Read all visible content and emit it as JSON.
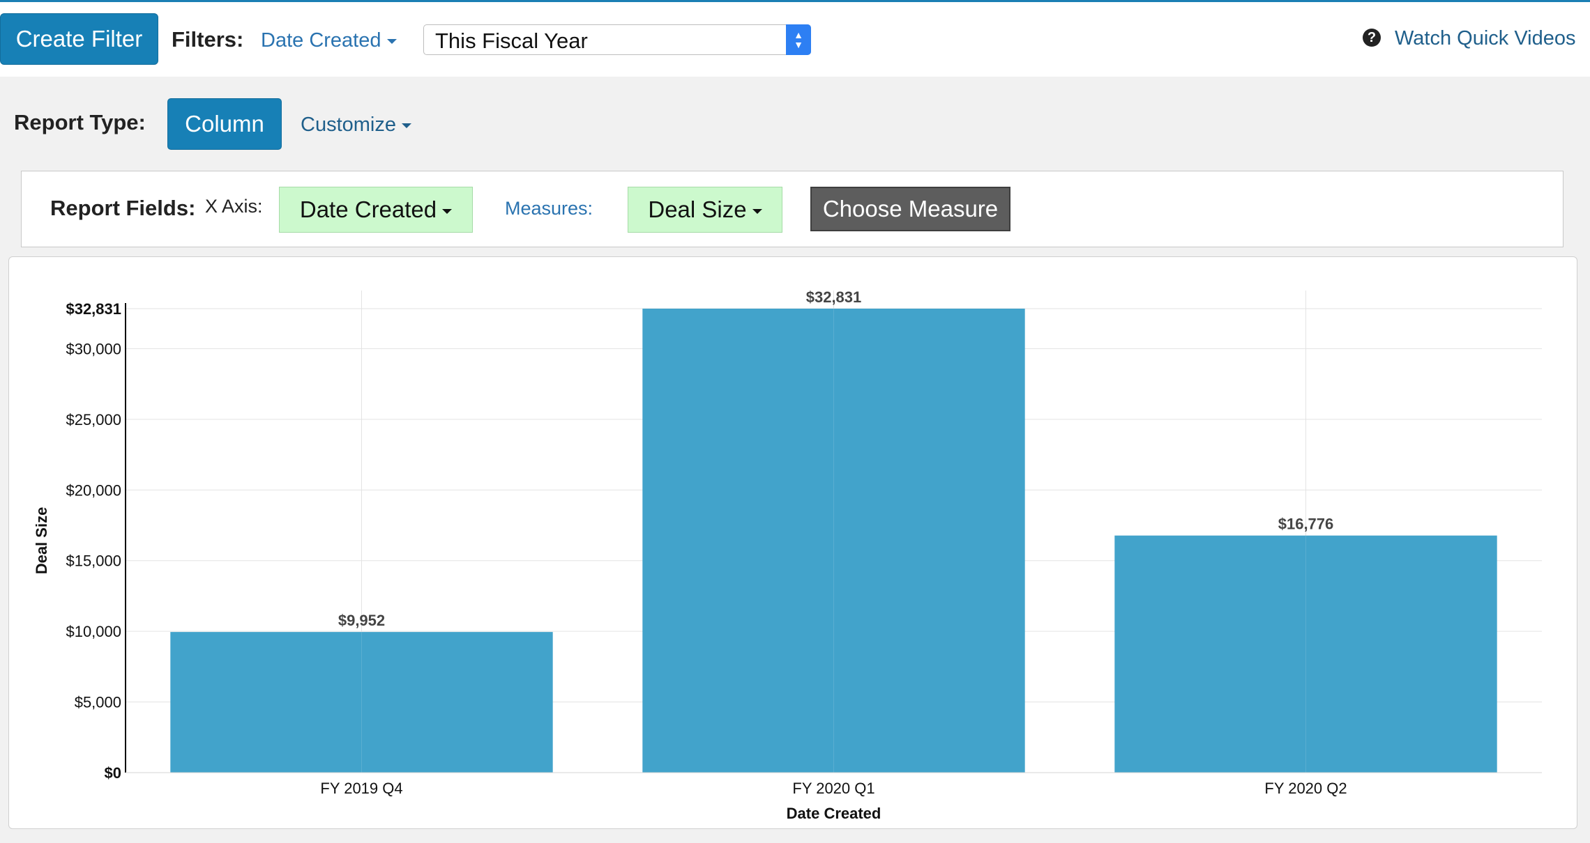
{
  "toolbar": {
    "create_filter_label": "Create Filter",
    "filters_label": "Filters:",
    "filter_field": "Date Created",
    "filter_value": "This Fiscal Year",
    "quick_videos_label": "Watch Quick Videos",
    "help_icon": "question-circle-icon"
  },
  "report_type": {
    "label": "Report Type:",
    "selected": "Column",
    "customize_label": "Customize"
  },
  "report_fields": {
    "label": "Report Fields:",
    "x_axis_label": "X Axis:",
    "x_axis_value": "Date Created",
    "measures_label": "Measures:",
    "measure_value": "Deal Size",
    "choose_measure_label": "Choose Measure"
  },
  "colors": {
    "accent": "#1780b6",
    "bar": "#42a3cb",
    "green_select": "#ccf9cd",
    "dark_button": "#5d5d5d",
    "link": "#2a73b0"
  },
  "chart_data": {
    "type": "bar",
    "categories": [
      "FY 2019 Q4",
      "FY 2020 Q1",
      "FY 2020 Q2"
    ],
    "values": [
      9952,
      32831,
      16776
    ],
    "value_labels": [
      "$9,952",
      "$32,831",
      "$16,776"
    ],
    "xlabel": "Date Created",
    "ylabel": "Deal Size",
    "ylim": [
      0,
      32831
    ],
    "yticks": [
      0,
      5000,
      10000,
      15000,
      20000,
      25000,
      30000,
      32831
    ],
    "ytick_labels": [
      "$0",
      "$5,000",
      "$10,000",
      "$15,000",
      "$20,000",
      "$25,000",
      "$30,000",
      "$32,831"
    ],
    "grid": true,
    "legend": "none"
  }
}
